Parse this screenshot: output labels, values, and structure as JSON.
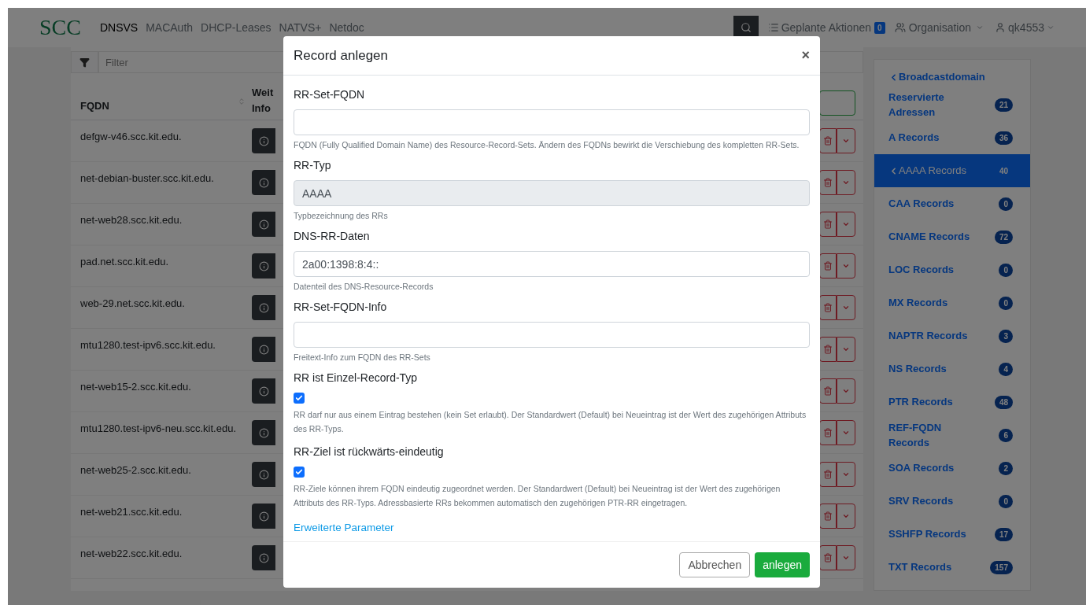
{
  "nav": {
    "logo": "SCC",
    "items": [
      {
        "label": "DNSVS",
        "selected": true
      },
      {
        "label": "MACAuth",
        "selected": false
      },
      {
        "label": "DHCP-Leases",
        "selected": false
      },
      {
        "label": "NATVS+",
        "selected": false
      },
      {
        "label": "Netdoc",
        "selected": false
      }
    ],
    "planned": {
      "label": "Geplante Aktionen",
      "count": "0"
    },
    "organisation": "Organisation",
    "user": "qk4553"
  },
  "filter": {
    "placeholder": "Filter"
  },
  "table": {
    "columns": [
      "FQDN",
      "Weit Info"
    ],
    "rows": [
      {
        "fqdn": "defgw-v46.scc.kit.edu."
      },
      {
        "fqdn": "net-debian-buster.scc.kit.edu."
      },
      {
        "fqdn": "net-web28.scc.kit.edu."
      },
      {
        "fqdn": "pad.net.scc.kit.edu."
      },
      {
        "fqdn": "web-29.net.scc.kit.edu."
      },
      {
        "fqdn": "mtu1280.test-ipv6.scc.kit.edu."
      },
      {
        "fqdn": "net-web15-2.scc.kit.edu."
      },
      {
        "fqdn": "mtu1280.test-ipv6-neu.scc.kit.edu."
      },
      {
        "fqdn": "net-web25-2.scc.kit.edu."
      },
      {
        "fqdn": "net-web21.scc.kit.edu."
      },
      {
        "fqdn": "net-web22.scc.kit.edu."
      }
    ]
  },
  "sidebar": {
    "back": "Broadcastdomain",
    "items": [
      {
        "label": "Reservierte Adressen",
        "count": "21",
        "selected": false
      },
      {
        "label": "A Records",
        "count": "36",
        "selected": false
      },
      {
        "label": "AAAA Records",
        "count": "40",
        "selected": true
      },
      {
        "label": "CAA Records",
        "count": "0",
        "selected": false
      },
      {
        "label": "CNAME Records",
        "count": "72",
        "selected": false
      },
      {
        "label": "LOC Records",
        "count": "0",
        "selected": false
      },
      {
        "label": "MX Records",
        "count": "0",
        "selected": false
      },
      {
        "label": "NAPTR Records",
        "count": "3",
        "selected": false
      },
      {
        "label": "NS Records",
        "count": "4",
        "selected": false
      },
      {
        "label": "PTR Records",
        "count": "48",
        "selected": false
      },
      {
        "label": "REF-FQDN Records",
        "count": "6",
        "selected": false
      },
      {
        "label": "SOA Records",
        "count": "2",
        "selected": false
      },
      {
        "label": "SRV Records",
        "count": "0",
        "selected": false
      },
      {
        "label": "SSHFP Records",
        "count": "17",
        "selected": false
      },
      {
        "label": "TXT Records",
        "count": "157",
        "selected": false
      }
    ]
  },
  "modal": {
    "title": "Record anlegen",
    "close": "×",
    "fields": [
      {
        "kind": "input",
        "label": "RR-Set-FQDN",
        "disabled": false,
        "help": "FQDN (Fully Qualified Domain Name) des Resource-Record-Sets. Ändern des FQDNs bewirkt die Verschiebung des kompletten RR-Sets."
      },
      {
        "kind": "input",
        "label": "RR-Typ",
        "value": "AAAA",
        "disabled": true,
        "help": "Typbezeichnung des RRs"
      },
      {
        "kind": "input",
        "label": "DNS-RR-Daten",
        "value": "2a00:1398:8:4::",
        "disabled": false,
        "help": "Datenteil des DNS-Resource-Records"
      },
      {
        "kind": "input",
        "label": "RR-Set-FQDN-Info",
        "disabled": false,
        "help": "Freitext-Info zum FQDN des RR-Sets"
      },
      {
        "kind": "checkbox",
        "label": "RR ist Einzel-Record-Typ",
        "checked": true,
        "help": "RR darf nur aus einem Eintrag bestehen (kein Set erlaubt). Der Standardwert (Default) bei Neueintrag ist der Wert des zugehörigen Attributs des RR-Typs."
      },
      {
        "kind": "checkbox",
        "label": "RR-Ziel ist rückwärts-eindeutig",
        "checked": true,
        "help": "RR-Ziele können ihrem FQDN eindeutig zugeordnet werden. Der Standardwert (Default) bei Neueintrag ist der Wert des zugehörigen Attributs des RR-Typs. Adressbasierte RRs bekommen automatisch den zugehörigen PTR-RR eingetragen."
      }
    ],
    "link": "Erweiterte Parameter",
    "buttons": [
      {
        "kind": "secondary",
        "label": "Abbrechen"
      },
      {
        "kind": "primary",
        "label": "anlegen"
      }
    ]
  }
}
